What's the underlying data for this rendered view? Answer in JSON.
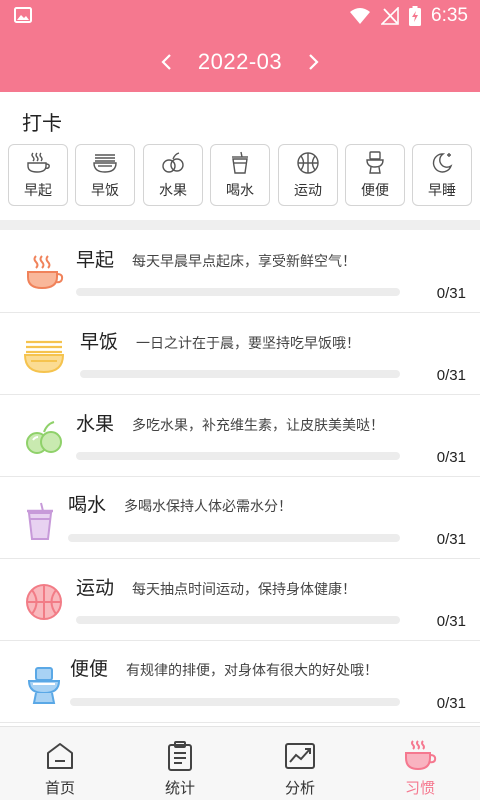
{
  "status_bar": {
    "time": "6:35"
  },
  "header": {
    "month": "2022-03",
    "prev_icon": "chevron-left-icon",
    "next_icon": "chevron-right-icon"
  },
  "checkin": {
    "title": "打卡",
    "buttons": [
      {
        "label": "早起",
        "icon": "coffee-cup-icon"
      },
      {
        "label": "早饭",
        "icon": "noodle-bowl-icon"
      },
      {
        "label": "水果",
        "icon": "fruit-icon"
      },
      {
        "label": "喝水",
        "icon": "drink-cup-icon"
      },
      {
        "label": "运动",
        "icon": "ball-icon"
      },
      {
        "label": "便便",
        "icon": "toilet-icon"
      },
      {
        "label": "早睡",
        "icon": "moon-icon"
      }
    ]
  },
  "habits": [
    {
      "name": "早起",
      "desc": "每天早晨早点起床，享受新鲜空气！",
      "count": "0/31",
      "progress": 0,
      "icon": "coffee-cup-icon",
      "color": "#f0825a"
    },
    {
      "name": "早饭",
      "desc": "一日之计在于晨，要坚持吃早饭哦！",
      "count": "0/31",
      "progress": 0,
      "icon": "noodle-bowl-icon",
      "color": "#f5c34e"
    },
    {
      "name": "水果",
      "desc": "多吃水果，补充维生素，让皮肤美美哒！",
      "count": "0/31",
      "progress": 0,
      "icon": "fruit-icon",
      "color": "#8fd16a"
    },
    {
      "name": "喝水",
      "desc": "多喝水保持人体必需水分！",
      "count": "0/31",
      "progress": 0,
      "icon": "drink-cup-icon",
      "color": "#c79ad9"
    },
    {
      "name": "运动",
      "desc": "每天抽点时间运动，保持身体健康！",
      "count": "0/31",
      "progress": 0,
      "icon": "ball-icon",
      "color": "#f27c86"
    },
    {
      "name": "便便",
      "desc": "有规律的排便，对身体有很大的好处哦！",
      "count": "0/31",
      "progress": 0,
      "icon": "toilet-icon",
      "color": "#5aa8e6"
    }
  ],
  "bottom_nav": [
    {
      "label": "首页",
      "icon": "home-icon",
      "active": false
    },
    {
      "label": "统计",
      "icon": "clipboard-icon",
      "active": false
    },
    {
      "label": "分析",
      "icon": "chart-trend-icon",
      "active": false
    },
    {
      "label": "习惯",
      "icon": "coffee-cup-icon",
      "active": true
    }
  ],
  "colors": {
    "accent": "#f5788f",
    "divider": "#efefef"
  }
}
